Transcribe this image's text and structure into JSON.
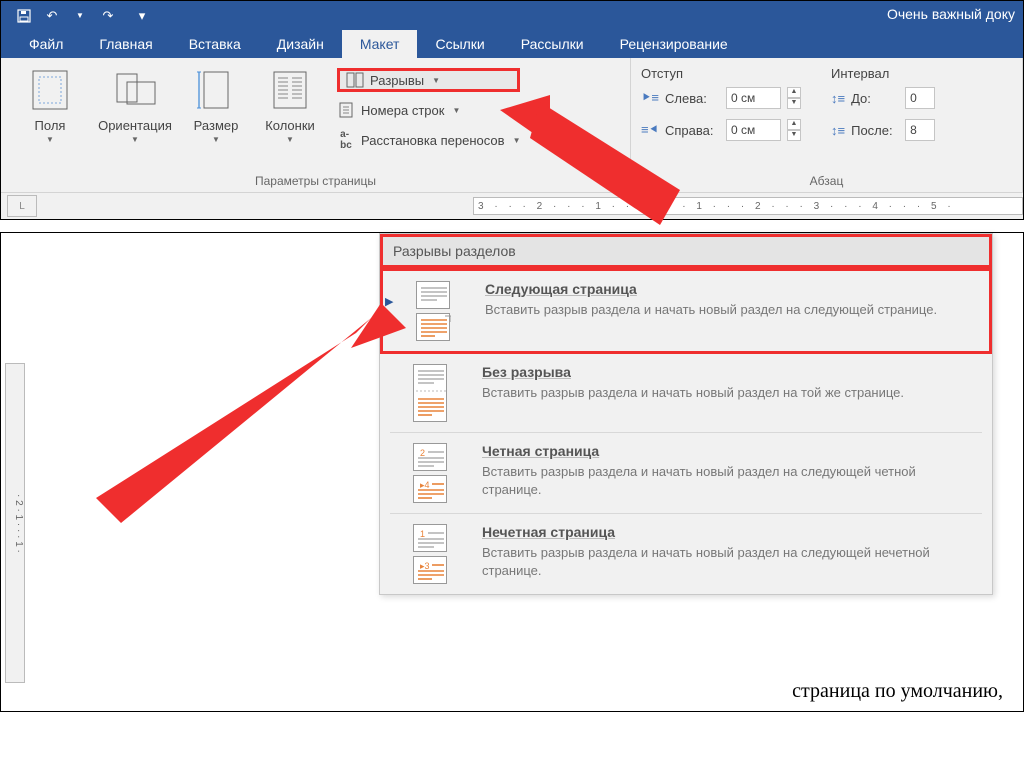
{
  "titlebar": {
    "title": "Очень важный доку"
  },
  "tabs": {
    "file": "Файл",
    "home": "Главная",
    "insert": "Вставка",
    "design": "Дизайн",
    "layout": "Макет",
    "references": "Ссылки",
    "mailings": "Рассылки",
    "review": "Рецензирование"
  },
  "ribbon": {
    "page_setup_group": "Параметры страницы",
    "margins": "Поля",
    "orientation": "Ориентация",
    "size": "Размер",
    "columns": "Колонки",
    "breaks": "Разрывы",
    "line_numbers": "Номера строк",
    "hyphenation": "Расстановка переносов",
    "paragraph_group": "Абзац",
    "indent_header": "Отступ",
    "spacing_header": "Интервал",
    "left": "Слева:",
    "right": "Справа:",
    "before": "До:",
    "after": "После:",
    "left_val": "0 см",
    "right_val": "0 см",
    "before_val": "0",
    "after_val": "8"
  },
  "dropdown": {
    "header": "Разрывы разделов",
    "items": [
      {
        "title": "Следующая страница",
        "desc": "Вставить разрыв раздела и начать новый раздел на следующей странице."
      },
      {
        "title": "Без разрыва",
        "desc": "Вставить разрыв раздела и начать новый раздел на той же странице."
      },
      {
        "title": "Четная страница",
        "desc": "Вставить разрыв раздела и начать новый раздел на следующей четной странице."
      },
      {
        "title": "Нечетная страница",
        "desc": "Вставить разрыв раздела и начать новый раздел на следующей нечетной странице."
      }
    ]
  },
  "doc": {
    "bottom_text": "страница по умолчанию,"
  },
  "ruler": "3 · · · 2 · · · 1 · · ·     · · · 1 · · · 2 · · · 3 · · · 4 · · · 5 ·",
  "vruler": "· 2 · 1 · · · 1 ·"
}
